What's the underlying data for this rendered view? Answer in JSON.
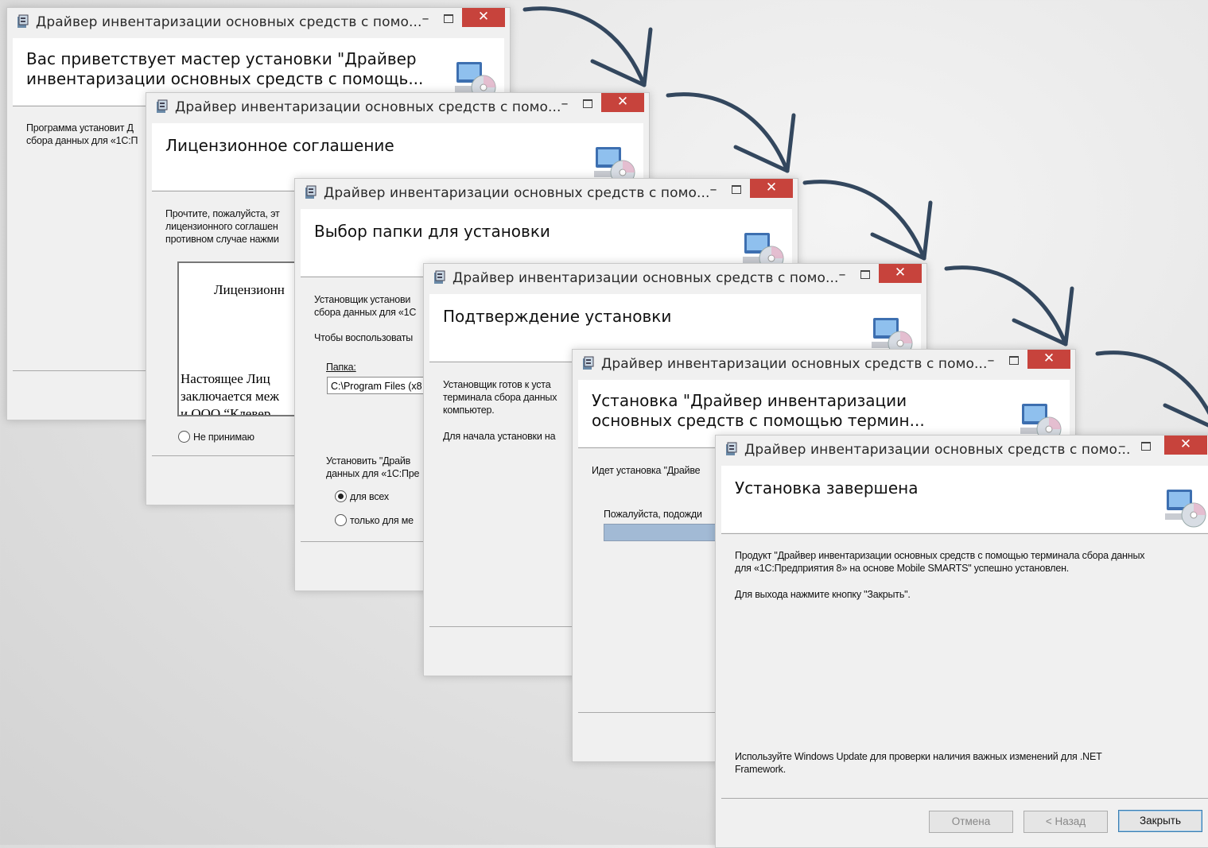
{
  "window_title": "Драйвер инвентаризации основных средств с помо...",
  "controls": {
    "minimize": "–",
    "close": "✕"
  },
  "colors": {
    "close_button": "#c7433c",
    "arrow": "#33475e",
    "progress": "#a2bad5",
    "primary_border": "#3c7fb1"
  },
  "windows": {
    "welcome": {
      "header_title": "Вас приветствует мастер установки \"Драйвер инвентаризации основных средств с помощь...",
      "body_line1": "Программа установит Д",
      "body_line2": "сбора данных для «1С:П"
    },
    "license": {
      "header_title": "Лицензионное соглашение",
      "body_line1": "Прочтите, пожалуйста, эт",
      "body_line2": "лицензионного соглашен",
      "body_line3": "противном случае нажми",
      "license_heading": "Лицензионн",
      "license_line1": "Настоящее Лиц",
      "license_line2": "заключается меж",
      "license_line3": "и ООО “Клевер",
      "decline_label": "Не принимаю"
    },
    "folder": {
      "header_title": "Выбор папки для установки",
      "body_line1": "Установщик установи",
      "body_line2": "сбора данных для «1С",
      "body_line3": "Чтобы воспользоваты",
      "folder_label": "Папка:",
      "folder_value": "C:\\Program Files (x8",
      "install_for_line1": "Установить \"Драйв",
      "install_for_line2": "данных для «1С:Пре",
      "option_everyone": "для всех",
      "option_me": "только для ме"
    },
    "confirm": {
      "header_title": "Подтверждение установки",
      "body_line1": "Установщик готов к уста",
      "body_line2": "терминала сбора данных",
      "body_line3": "компьютер.",
      "body_line4": "Для начала установки на"
    },
    "progress": {
      "header_title": "Установка \"Драйвер инвентаризации основных средств с помощью термин...",
      "body_line1": "Идет установка \"Драйве",
      "wait_label": "Пожалуйста, подожди",
      "progress_fraction": 0.3
    },
    "finish": {
      "header_title": "Установка завершена",
      "product_line1": "Продукт \"Драйвер инвентаризации основных средств с помощью терминала сбора данных",
      "product_line2": "для «1С:Предприятия 8» на основе Mobile SMARTS\" успешно установлен.",
      "exit_hint": "Для выхода нажмите кнопку \"Закрыть\".",
      "update_line1": "Используйте Windows Update для проверки наличия важных изменений для .NET",
      "update_line2": "Framework.",
      "cancel_button": "Отмена",
      "back_button": "< Назад",
      "close_button": "Закрыть"
    }
  }
}
